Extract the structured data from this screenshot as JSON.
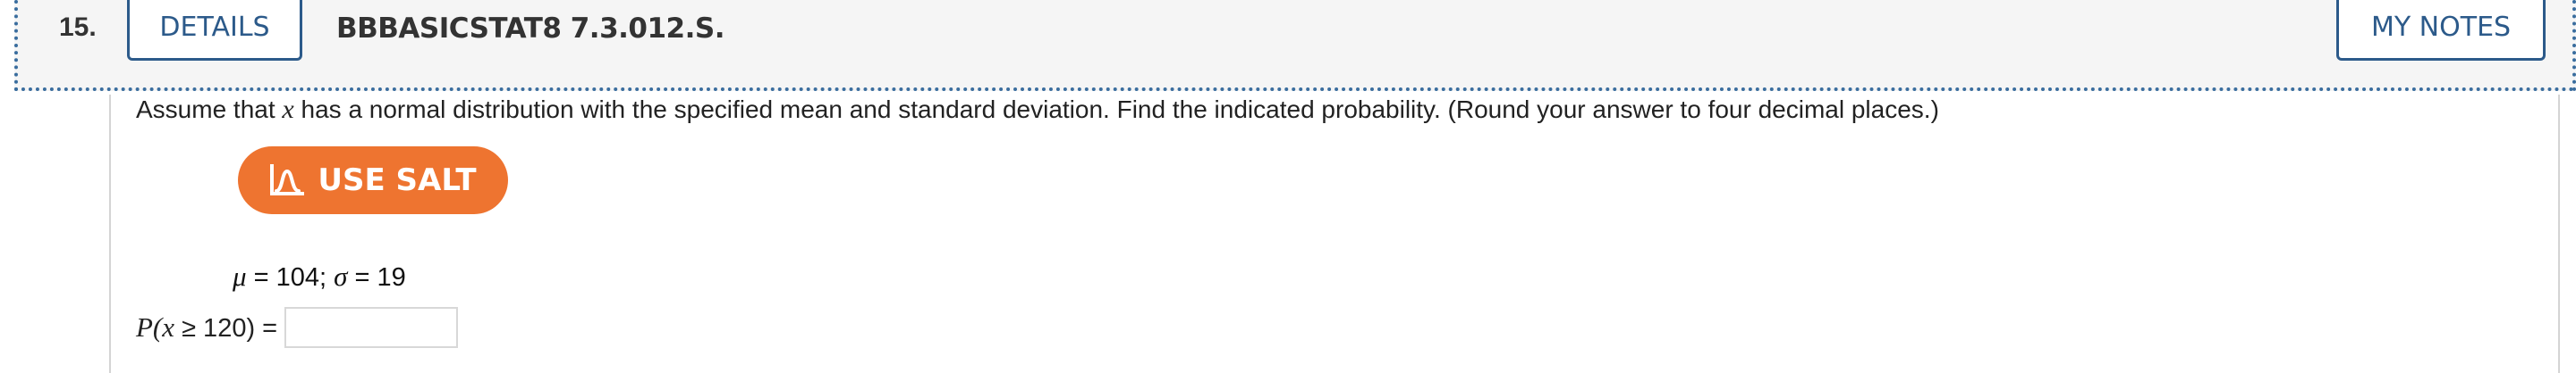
{
  "header": {
    "question_number": "15.",
    "details_label": "DETAILS",
    "reference": "BBBASICSTAT8 7.3.012.S.",
    "my_notes_label": "MY NOTES"
  },
  "question": {
    "prompt_before_var": "Assume that ",
    "prompt_var": "x",
    "prompt_after_var": " has a normal distribution with the specified mean and standard deviation. Find the indicated probability. (Round your answer to four decimal places.)",
    "salt_button_label": "USE SALT",
    "mu_symbol": "μ",
    "mu_value": " = 104; ",
    "sigma_symbol": "σ",
    "sigma_value": " = 19",
    "prob_open": "P(",
    "prob_var": "x",
    "prob_rest": " ≥ 120) =",
    "answer_value": ""
  },
  "colors": {
    "accent": "#2c5a8a",
    "salt_orange": "#ee7430",
    "header_bg": "#f5f5f5"
  },
  "icons": {
    "salt": "bell-curve-icon"
  }
}
